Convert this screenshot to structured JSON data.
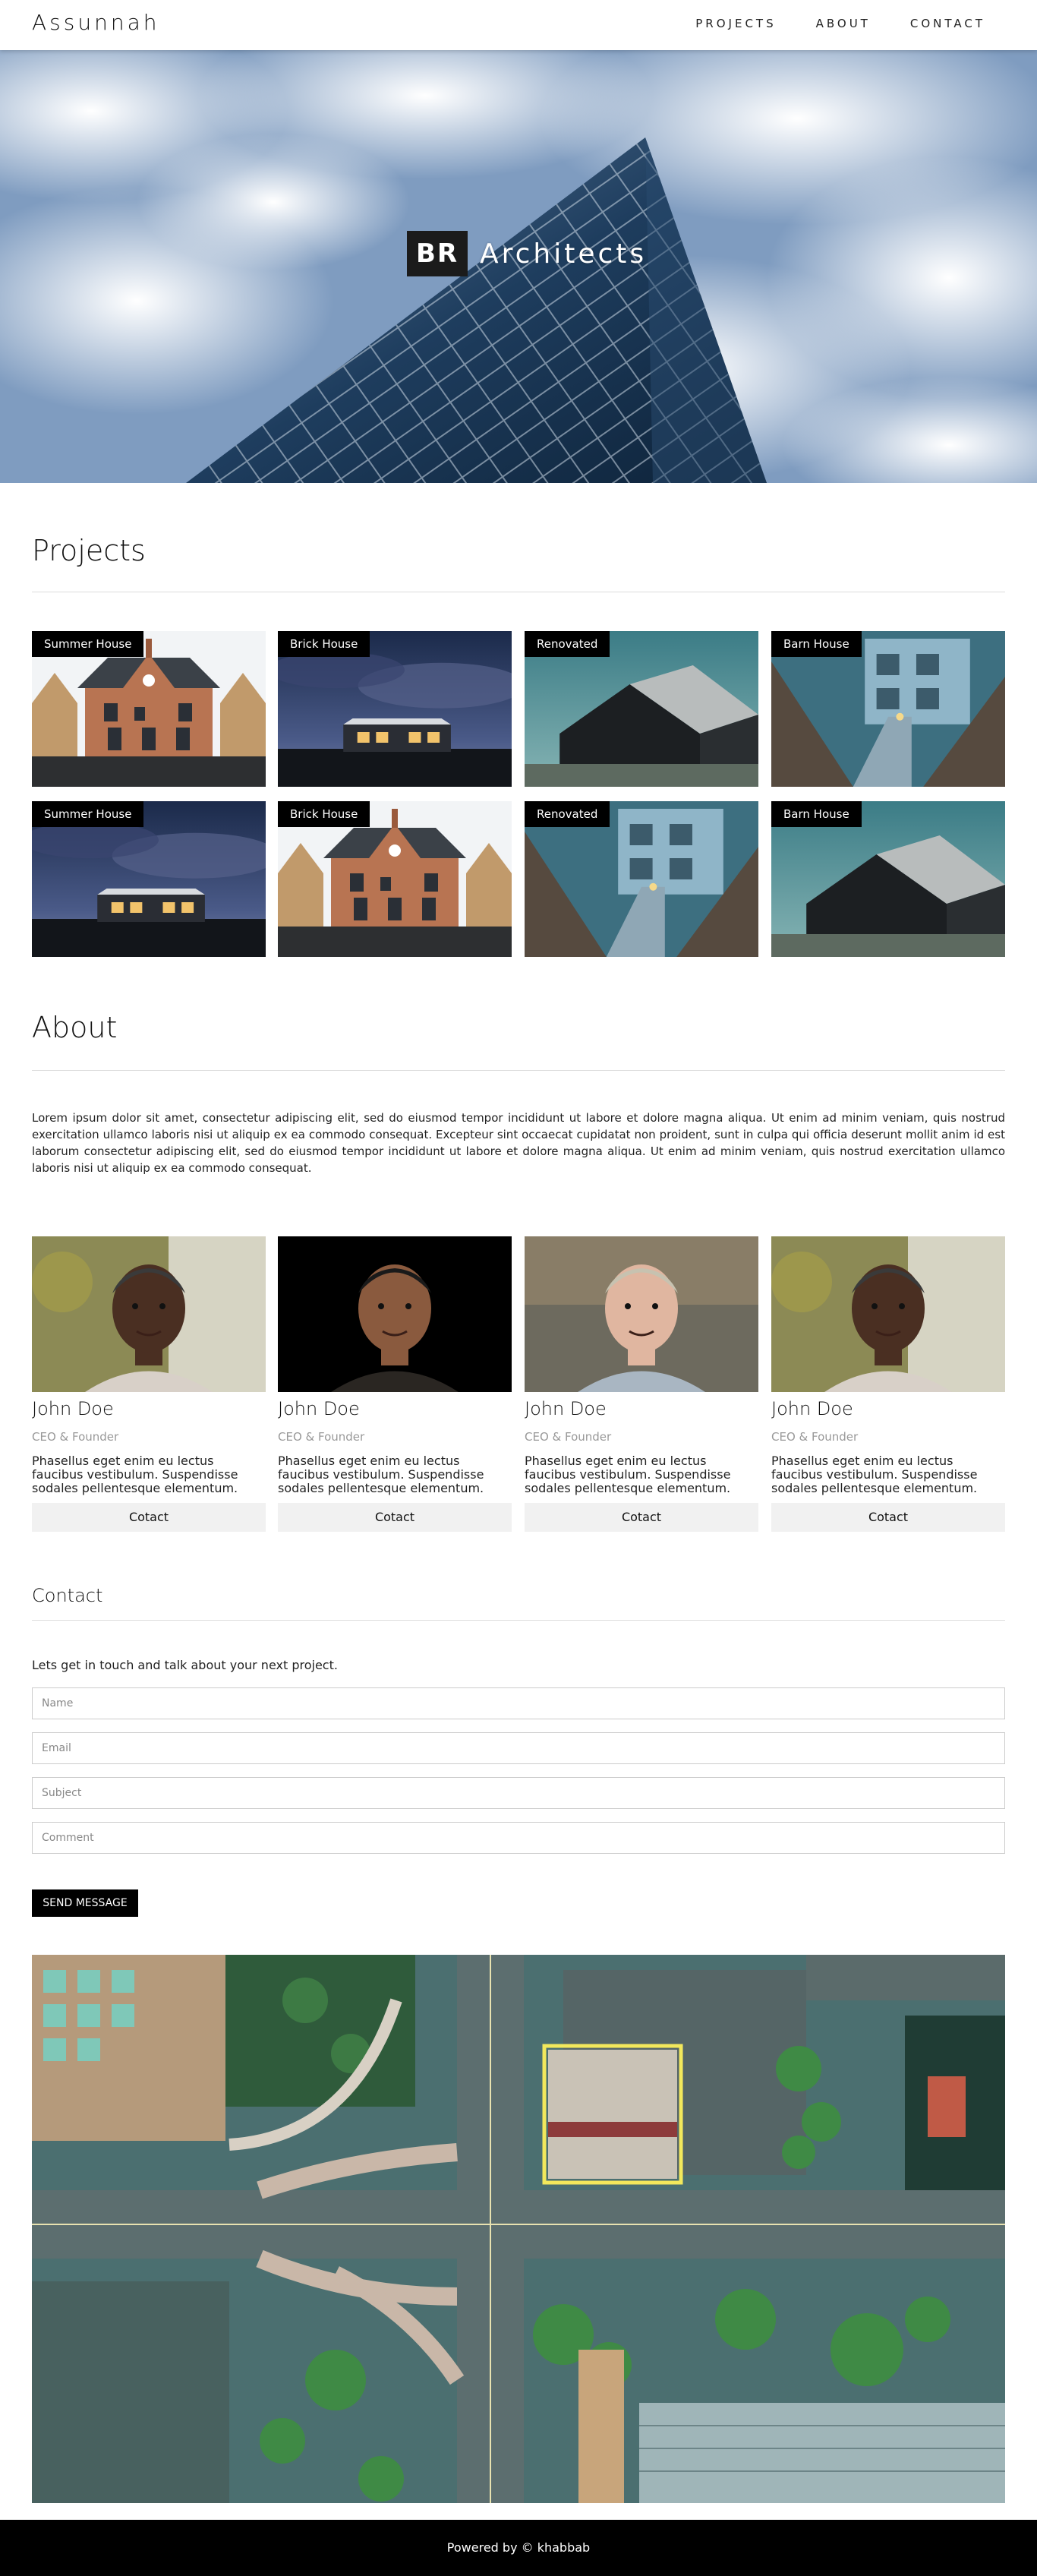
{
  "nav": {
    "brand": "Assunnah",
    "links": [
      "PROJECTS",
      "ABOUT",
      "CONTACT"
    ]
  },
  "hero": {
    "badge": "BR",
    "title": "Architects"
  },
  "projects": {
    "heading": "Projects",
    "items": [
      {
        "tag": "Summer House",
        "scene": "brick"
      },
      {
        "tag": "Brick House",
        "scene": "night"
      },
      {
        "tag": "Renovated",
        "scene": "barn"
      },
      {
        "tag": "Barn House",
        "scene": "blue"
      },
      {
        "tag": "Summer House",
        "scene": "night"
      },
      {
        "tag": "Brick House",
        "scene": "brick"
      },
      {
        "tag": "Renovated",
        "scene": "blue"
      },
      {
        "tag": "Barn House",
        "scene": "barn"
      }
    ]
  },
  "about": {
    "heading": "About",
    "text": "Lorem ipsum dolor sit amet, consectetur adipiscing elit, sed do eiusmod tempor incididunt ut labore et dolore magna aliqua. Ut enim ad minim veniam, quis nostrud exercitation ullamco laboris nisi ut aliquip ex ea commodo consequat. Excepteur sint occaecat cupidatat non proident, sunt in culpa qui officia deserunt mollit anim id est laborum consectetur adipiscing elit, sed do eiusmod tempor incididunt ut labore et dolore magna aliqua. Ut enim ad minim veniam, quis nostrud exercitation ullamco laboris nisi ut aliquip ex ea commodo consequat.",
    "team": [
      {
        "name": "John Doe",
        "role": "CEO & Founder",
        "desc": "Phasellus eget enim eu lectus faucibus vestibulum. Suspendisse sodales pellentesque elementum.",
        "button": "Cotact"
      },
      {
        "name": "John Doe",
        "role": "CEO & Founder",
        "desc": "Phasellus eget enim eu lectus faucibus vestibulum. Suspendisse sodales pellentesque elementum.",
        "button": "Cotact"
      },
      {
        "name": "John Doe",
        "role": "CEO & Founder",
        "desc": "Phasellus eget enim eu lectus faucibus vestibulum. Suspendisse sodales pellentesque elementum.",
        "button": "Cotact"
      },
      {
        "name": "John Doe",
        "role": "CEO & Founder",
        "desc": "Phasellus eget enim eu lectus faucibus vestibulum. Suspendisse sodales pellentesque elementum.",
        "button": "Cotact"
      }
    ]
  },
  "contact": {
    "heading": "Contact",
    "subtitle": "Lets get in touch and talk about your next project.",
    "fields": {
      "name": "Name",
      "email": "Email",
      "subject": "Subject",
      "comment": "Comment"
    },
    "send": "SEND MESSAGE"
  },
  "footer": {
    "text": "Powered by © khabbab"
  },
  "colors": {
    "accent": "#000000",
    "button_bg": "#f1f1f1",
    "footer_bg": "#000000"
  }
}
